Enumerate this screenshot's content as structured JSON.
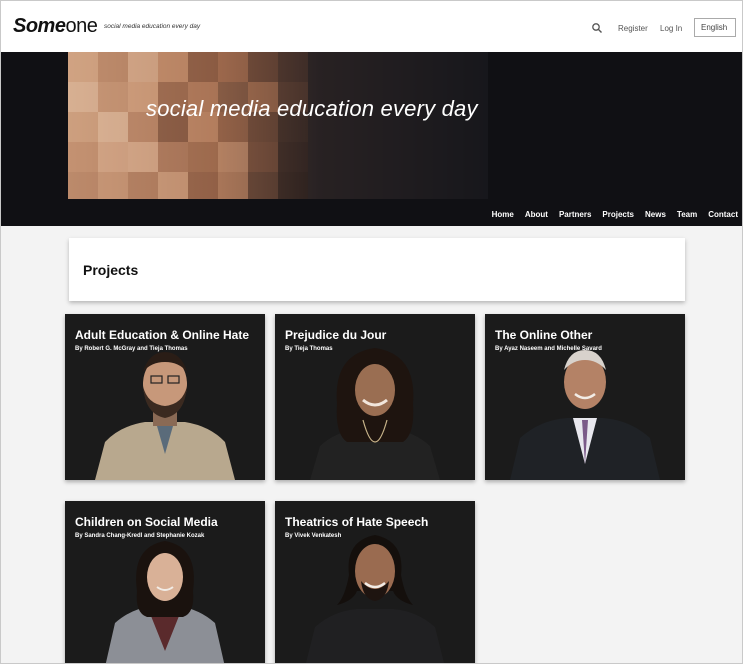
{
  "header": {
    "logo_bold": "Some",
    "logo_light": "one",
    "tagline": "social media education every day",
    "register": "Register",
    "login": "Log In",
    "language": "English"
  },
  "hero": {
    "headline": "social media education every day"
  },
  "nav": [
    "Home",
    "About",
    "Partners",
    "Projects",
    "News",
    "Team",
    "Contact"
  ],
  "section": {
    "title": "Projects"
  },
  "projects": [
    {
      "title": "Adult Education & Online Hate",
      "by": "By Robert G. McGray and Tieja Thomas"
    },
    {
      "title": "Prejudice du Jour",
      "by": "By Tieja Thomas"
    },
    {
      "title": "The Online Other",
      "by": "By Ayaz Naseem and Michelle Savard"
    },
    {
      "title": "Children on Social Media",
      "by": "By Sandra Chang-Kredl and Stephanie Kozak"
    },
    {
      "title": "Theatrics of Hate Speech",
      "by": "By Vivek Venkatesh"
    }
  ],
  "icons": {
    "search": "search-icon"
  },
  "colors": {
    "hero_bg": "#101014",
    "card_bg": "#1a1a1a",
    "page_bg": "#f3f3f3"
  }
}
